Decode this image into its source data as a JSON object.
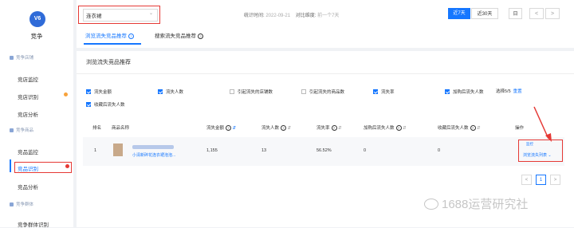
{
  "sidebar": {
    "logo_text": "V6",
    "brand": "竞争",
    "sections": [
      {
        "label": "竞争店铺",
        "items": [
          "竞店监控",
          "竞店识别",
          "竞店分析"
        ]
      },
      {
        "label": "竞争商品",
        "items": [
          "竞品监控",
          "竞品识别",
          "竞品分析"
        ]
      },
      {
        "label": "竞争群体",
        "items": [
          "竞争群体识别"
        ]
      }
    ],
    "active_item": "竞品识别"
  },
  "header": {
    "category_value": "连衣裙",
    "stat_label": "统计时间:",
    "stat_value": "2022-09-21",
    "compare_label": "对比维度:",
    "compare_value": "前一个7天",
    "btn_7days": "近7天",
    "btn_30days": "近30天",
    "btn_day": "日",
    "prev": "<",
    "next": ">",
    "tabs": [
      "浏览流失竞品推荐",
      "搜索流失竞品推荐"
    ]
  },
  "panel": {
    "title": "浏览流失竞品推荐",
    "checkboxes": [
      {
        "label": "流失金额",
        "checked": true
      },
      {
        "label": "流失人数",
        "checked": true
      },
      {
        "label": "引起流失的店铺数",
        "checked": false
      },
      {
        "label": "引起流失的商品数",
        "checked": false
      },
      {
        "label": "流失率",
        "checked": true
      },
      {
        "label": "加购后流失人数",
        "checked": true
      },
      {
        "label": "收藏后流失人数",
        "checked": true
      }
    ],
    "select_count": "选择5/5",
    "reset": "重置",
    "columns": [
      "排名",
      "商品名称",
      "流失金额",
      "流失人数",
      "流失率",
      "加购后流失人数",
      "收藏后流失人数",
      "操作"
    ],
    "row": {
      "rank": "1",
      "product_link": "小清新碎花连衣裙泡泡...",
      "loss_amount": "1,155",
      "loss_users": "13",
      "loss_rate": "56.52%",
      "cart_loss": "0",
      "fav_loss": "0",
      "op_top": "监控",
      "op_link": "浏览流失列表"
    },
    "pagination": {
      "prev": "<",
      "page": "1",
      "next": ">"
    }
  },
  "watermark": "1688运营研究社"
}
